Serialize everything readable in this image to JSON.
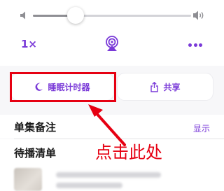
{
  "volume": {
    "level_percent": 27,
    "low_icon": "speaker-low-icon",
    "high_icon": "speaker-high-icon"
  },
  "controls": {
    "speed_label": "1×",
    "airplay_icon": "airplay-icon",
    "more_icon": "ellipsis-icon",
    "accent_color": "#7a3ad8"
  },
  "buttons": {
    "sleep_timer": {
      "label": "睡眠计时器",
      "icon": "moon-icon"
    },
    "share": {
      "label": "共享",
      "icon": "share-icon"
    }
  },
  "sections": {
    "episode_notes": {
      "title": "单集备注",
      "action": "显示"
    },
    "up_next": {
      "title": "待播清单"
    }
  },
  "annotation": {
    "text": "点击此处",
    "color": "#e60012"
  }
}
